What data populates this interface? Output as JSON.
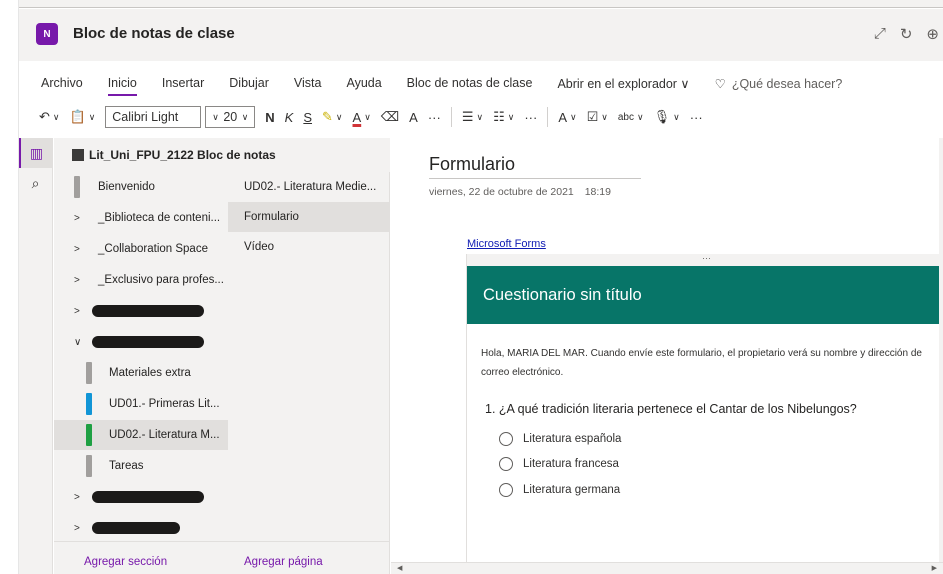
{
  "app": {
    "title": "Bloc de notas de clase",
    "icon_label": "N"
  },
  "header_icons": [
    "expand-icon",
    "refresh-icon",
    "globe-icon"
  ],
  "menu": {
    "items": [
      "Archivo",
      "Inicio",
      "Insertar",
      "Dibujar",
      "Vista",
      "Ayuda",
      "Bloc de notas de clase",
      "Abrir en el explorador ∨",
      "¿Qué desea hacer?"
    ],
    "active": "Inicio"
  },
  "toolbar": {
    "font_name": "Calibri Light",
    "font_size": "20",
    "bold": "N",
    "italic": "K",
    "underline": "S",
    "more": "···"
  },
  "notebook": {
    "title": "Lit_Uni_FPU_2122 Bloc de notas"
  },
  "sections": {
    "items": [
      {
        "label": "Bienvenido"
      },
      {
        "label": "_Biblioteca de conteni..."
      },
      {
        "label": "_Collaboration Space"
      },
      {
        "label": "_Exclusivo para profes..."
      }
    ],
    "sub_items": [
      {
        "label": "Materiales extra",
        "color": "#a19f9d"
      },
      {
        "label": "UD01.- Primeras Lit...",
        "color": "#1195d6"
      },
      {
        "label": "UD02.- Literatura M...",
        "color": "#1fa043"
      },
      {
        "label": "Tareas",
        "color": "#a19f9d"
      }
    ],
    "add_label": "Agregar sección"
  },
  "pages": {
    "items": [
      "UD02.- Literatura Medie...",
      "Formulario",
      "Vídeo"
    ],
    "selected": "Formulario",
    "add_label": "Agregar página"
  },
  "page": {
    "title": "Formulario",
    "date": "viernes, 22 de octubre de 2021",
    "time": "18:19",
    "link": "Microsoft Forms"
  },
  "form": {
    "title": "Cuestionario sin título",
    "intro_line1": "Hola, MARIA DEL MAR. Cuando envíe este formulario, el propietario verá su nombre y dirección de",
    "intro_line2": "correo electrónico.",
    "question": "1. ¿A qué tradición literaria pertenece el Cantar de los Nibelungos?",
    "options": [
      "Literatura española",
      "Literatura francesa",
      "Literatura germana"
    ],
    "dots": "···"
  },
  "colors": {
    "accent": "#7719aa",
    "form_header": "#077568",
    "link": "#0f1bb3"
  }
}
